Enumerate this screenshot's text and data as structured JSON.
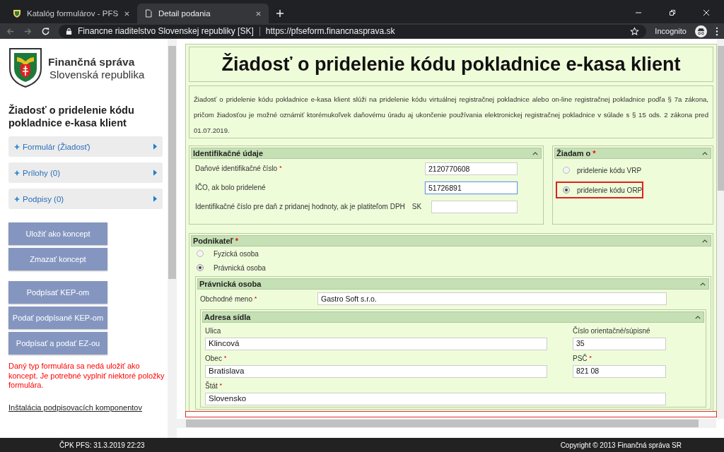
{
  "browser": {
    "tabs": [
      {
        "title": "Katalóg formulárov - PFS",
        "selected": false,
        "kind": "site"
      },
      {
        "title": "Detail podania",
        "selected": true,
        "kind": "page"
      }
    ],
    "site_name": "Financne riaditelstvo Slovenskej republiky [SK]",
    "url": "https://pfseform.financnasprava.sk",
    "profile": "Incognito"
  },
  "sidebar": {
    "brand": {
      "name": "Finančná správa",
      "subtitle": "Slovenská republika"
    },
    "form_title": "Žiadosť o pridelenie kódu pokladnice e-kasa klient",
    "sections": [
      {
        "label": "Formulár (Žiadosť)"
      },
      {
        "label": "Prílohy (0)"
      },
      {
        "label": "Podpisy (0)"
      }
    ],
    "button_groups": [
      [
        "Uložiť ako koncept",
        "Zmazať koncept"
      ],
      [
        "Podpísať KEP-om",
        "Podať podpísané KEP-om",
        "Podpísať a podať EZ-ou"
      ]
    ],
    "error": "Daný typ formulára sa nedá uložiť ako koncept. Je potrebné vyplniť niektoré položky formulára.",
    "link": "Inštalácia podpisovacích komponentov"
  },
  "form": {
    "title": "Žiadosť o pridelenie kódu pokladnice e-kasa klient",
    "description": "Žiadosť o pridelenie kódu pokladnice e-kasa klient slúži na pridelenie kódu virtuálnej registračnej pokladnice alebo on-line registračnej pokladnice podľa § 7a zákona, pričom žiadosťou je možné oznámiť ktorémukoľvek daňovému úradu aj ukončenie používania elektronickej registračnej pokladnice v súlade s § 15 ods. 2 zákona pred 01.07.2019.",
    "identification": {
      "title": "Identifikačné údaje",
      "fields": [
        {
          "label": "Daňové identifikačné číslo",
          "required_mark": "*",
          "value": "2120770608",
          "focused": false
        },
        {
          "label": "IČO, ak bolo pridelené",
          "value": "51726891",
          "focused": true
        },
        {
          "label": "Identifikačné číslo pre daň z pridanej hodnoty, ak je platiteľom DPH",
          "prefix": "SK",
          "focused": false
        }
      ]
    },
    "request": {
      "title": "Žiadam o",
      "required_mark": "*",
      "options": [
        {
          "label": "pridelenie kódu VRP",
          "selected": false,
          "highlighted": false
        },
        {
          "label": "pridelenie kódu ORP",
          "selected": true,
          "highlighted": true
        }
      ]
    },
    "entrepreneur": {
      "title": "Podnikateľ",
      "required_mark": "*",
      "options": [
        {
          "label": "Fyzická osoba",
          "selected": false
        },
        {
          "label": "Právnická osoba",
          "selected": true
        }
      ],
      "legal_person": {
        "title": "Právnická osoba",
        "name_field": {
          "label": "Obchodné meno",
          "required_mark": "*",
          "value": "Gastro Soft s.r.o."
        },
        "address": {
          "title": "Adresa sídla",
          "fields": [
            {
              "label": "Ulica",
              "value": "Klincová",
              "kind": "wide"
            },
            {
              "label": "Číslo orientačné/súpisné",
              "value": "35",
              "kind": "short"
            },
            {
              "label": "Obec",
              "required_mark": "*",
              "value": "Bratislava",
              "kind": "wide"
            },
            {
              "label": "PSČ",
              "required_mark": "*",
              "value": "821 08",
              "kind": "short"
            },
            {
              "label": "Štát",
              "required_mark": "*",
              "value": "Slovensko",
              "kind": "full"
            }
          ]
        }
      }
    }
  },
  "footer": {
    "left": "ČPK PFS: 31.3.2019 22:23",
    "right": "Copyright © 2013 Finančná správa SR"
  }
}
